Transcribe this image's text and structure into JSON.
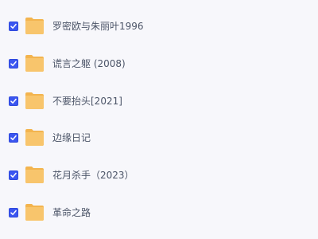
{
  "files": [
    {
      "name": "罗密欧与朱丽叶1996",
      "checked": true,
      "icon": "folder-icon"
    },
    {
      "name": "谎言之躯 (2008)",
      "checked": true,
      "icon": "folder-icon"
    },
    {
      "name": "不要抬头[2021]",
      "checked": true,
      "icon": "folder-icon"
    },
    {
      "name": "边缘日记",
      "checked": true,
      "icon": "folder-icon"
    },
    {
      "name": "花月杀手（2023）",
      "checked": true,
      "icon": "folder-icon"
    },
    {
      "name": "革命之路",
      "checked": true,
      "icon": "folder-icon"
    }
  ],
  "colors": {
    "background": "#f7f7fb",
    "checkbox": "#3b56f0",
    "folder": "#f8c56c",
    "folder_tab": "#f3b44e",
    "text": "#4c5568"
  }
}
